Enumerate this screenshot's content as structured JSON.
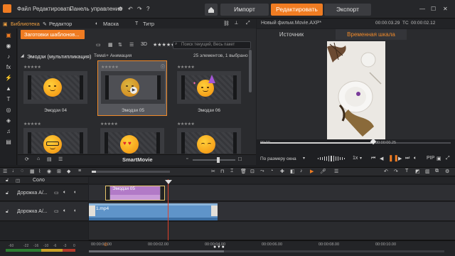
{
  "menu": [
    "Файл",
    "Редактировать",
    "Панель управления"
  ],
  "nav": {
    "import": "Импорт",
    "edit": "Редактировать",
    "export": "Экспорт"
  },
  "library": {
    "tabs": {
      "library": "Библиотека",
      "editor": "Редактор",
      "mask": "Маска",
      "title": "Титр"
    },
    "templates_button": "Заготовки шаблонов...",
    "search_placeholder": "Поиск текущий, Весь пакет",
    "view_3d": "3D",
    "folder": "Эмодзи (мультипликация)",
    "breadcrumb": "Тема\\+ Анимация",
    "count": "25 элементов, 1 выбрано",
    "items": [
      {
        "name": "Эмодзи 04",
        "stars": "★★★★★",
        "selected": false
      },
      {
        "name": "Эмодзи 05",
        "stars": "★★★★★",
        "selected": true
      },
      {
        "name": "Эмодзи 06",
        "stars": "★★★★★",
        "selected": false
      },
      {
        "name": "",
        "stars": "★★★★★",
        "selected": false
      },
      {
        "name": "",
        "stars": "★★★★★",
        "selected": false
      },
      {
        "name": "",
        "stars": "★★★★★",
        "selected": false
      }
    ],
    "footer": "SmartMovie"
  },
  "player": {
    "title": "Новый фильм.Movie.AXP*",
    "tc1": "00:00:03.29",
    "tc_label": "TC",
    "tc2": "00:00:02.12",
    "tabs": {
      "source": "Источник",
      "timeline": "Временная шкала"
    },
    "scrub_start": "00:00",
    "scrub_pos": "00:00:00.25",
    "fit": "По размеру окна",
    "speed": "1x",
    "pip": "PIP"
  },
  "timeline": {
    "solo": "Соло",
    "tracks": [
      {
        "name": "Дорожка A/..."
      },
      {
        "name": "Дорожка A/..."
      }
    ],
    "clips": {
      "emoji": "Эмодзи 05",
      "video": "1.mp4"
    },
    "ticks": [
      "00:00:00.00",
      "00:00:02.00",
      "00:00:04.00",
      "00:00:06.00",
      "00:00:08.00",
      "00:00:10.00"
    ],
    "vu_ticks": [
      "-60",
      "-22",
      "-16",
      "-10",
      "-6",
      "-3",
      "0"
    ]
  },
  "colors": {
    "accent": "#f07c22",
    "playhead": "#e0402a",
    "clip_title": "#b27ac7",
    "clip_video": "#5f94c9"
  }
}
